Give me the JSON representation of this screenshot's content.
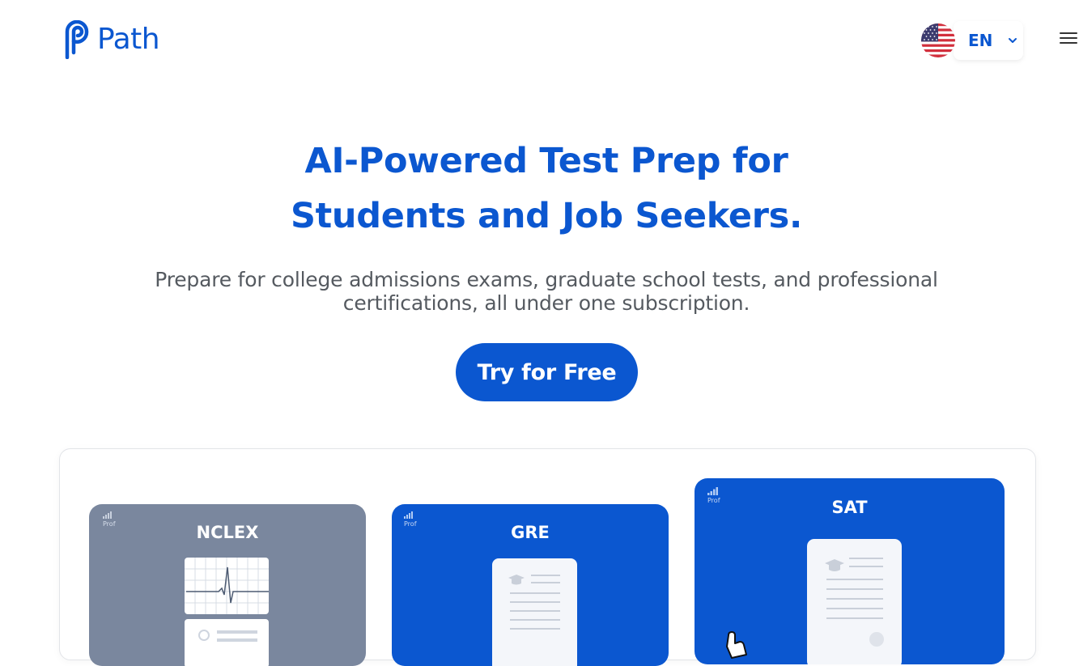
{
  "header": {
    "brand": "Path",
    "language": {
      "code": "EN"
    }
  },
  "hero": {
    "title_line1": "AI-Powered Test Prep for",
    "title_line2": "Students and Job Seekers.",
    "subtitle_line1": "Prepare for college admissions exams, graduate school tests, and professional",
    "subtitle_line2": "certifications, all under one subscription.",
    "cta_label": "Try for Free"
  },
  "exams": [
    {
      "name": "NCLEX",
      "level": "Prof",
      "color": "#7a879e",
      "illustration": "ecg-chart-icon"
    },
    {
      "name": "GRE",
      "level": "Prof",
      "color": "#0b57d0",
      "illustration": "document-icon"
    },
    {
      "name": "SAT",
      "level": "Prof",
      "color": "#0b57d0",
      "illustration": "certificate-icon"
    }
  ],
  "colors": {
    "brand": "#0b57d0",
    "subtitle": "#555a60",
    "nclex_card": "#7a879e"
  }
}
